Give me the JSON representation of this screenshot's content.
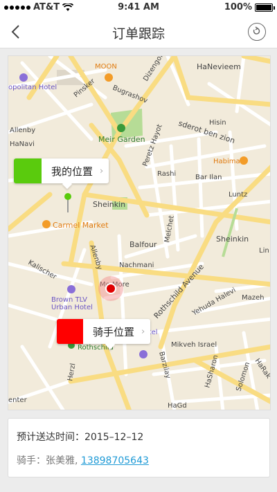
{
  "status_bar": {
    "carrier": "AT&T",
    "time": "9:41 AM",
    "battery": "100%"
  },
  "navbar": {
    "title": "订单跟踪",
    "back_icon": "chevron-left-icon",
    "refresh_icon": "refresh-icon"
  },
  "map": {
    "labels": {
      "moon": "MOON",
      "hanevieem": "HaNevieem",
      "politan_hotel": "opolitan Hotel",
      "pinsker": "Pinsker",
      "bugrashov": "Bugrashov",
      "dizengoff": "Dizengoff",
      "meir_garden": "Meir Garden",
      "sderot": "sderot ben zion",
      "hisin": "Hisin",
      "allenby_top": "Allenby",
      "hanavi": "HaNavi",
      "peretz": "Peretz Hayot",
      "habima": "Habima",
      "rashi": "Rashi",
      "bar_ilan": "Bar Ilan",
      "luntz": "Luntz",
      "sheinkin": "Sheinkin",
      "carmel": "Carmel Market",
      "melchet": "Melchet",
      "balfour": "Balfour",
      "sheinkin2": "Sheinkin",
      "allenby": "Allenby",
      "nachmani": "Nachmani",
      "kalischer": "Kalischer",
      "brown": "Brown TLV",
      "urban": "Urban Hotel",
      "rothschild_ave": "Rothschild Avenue",
      "yehuda": "Yehuda Halevi",
      "mazeh": "Mazeh",
      "rothschild": "Rothschild",
      "aviv": "Aviv Hotel",
      "mikveh": "Mikveh Israel",
      "herzl": "Herzl",
      "barzilay": "Barzilay",
      "hasharon": "HaSharon",
      "solomon": "Solomon",
      "harakevet": "HaRak",
      "hagd": "HaGd",
      "more": "Mo  More",
      "lin": "Lin",
      "enter": "enter"
    },
    "my_location": {
      "label": "我的位置",
      "color": "#5acb0d"
    },
    "rider_location": {
      "label": "骑手位置",
      "color": "#ff0000"
    }
  },
  "info": {
    "eta_label": "预计送达时间：",
    "eta_value": "2015–12–12",
    "rider_label": "骑手：",
    "rider_name": "张美雅,",
    "rider_phone": "13898705643"
  }
}
